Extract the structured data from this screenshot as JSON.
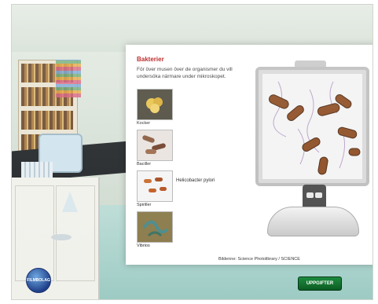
{
  "panel": {
    "title": "Bakterier",
    "description": "För över musen över de organismer du vill undersöka närmare under mikroskopet."
  },
  "thumbnails": [
    {
      "label": "Kocker",
      "icon": "cocci-thumbnail"
    },
    {
      "label": "Baciller",
      "icon": "bacilli-thumbnail"
    },
    {
      "label": "Spiriller",
      "icon": "spirilla-thumbnail"
    },
    {
      "label": "Vibrios",
      "icon": "vibrio-thumbnail"
    }
  ],
  "spiral_label": "Helicobacter pylori",
  "credit": "Bildenne: Science Photolibrary / SCIENCE",
  "next_button": "UPPGIFTER",
  "logo_text": "FILMBOLAG",
  "colors": {
    "title": "#b51010",
    "button": "#0b5a22",
    "bacteria": "#8b4a1f"
  }
}
